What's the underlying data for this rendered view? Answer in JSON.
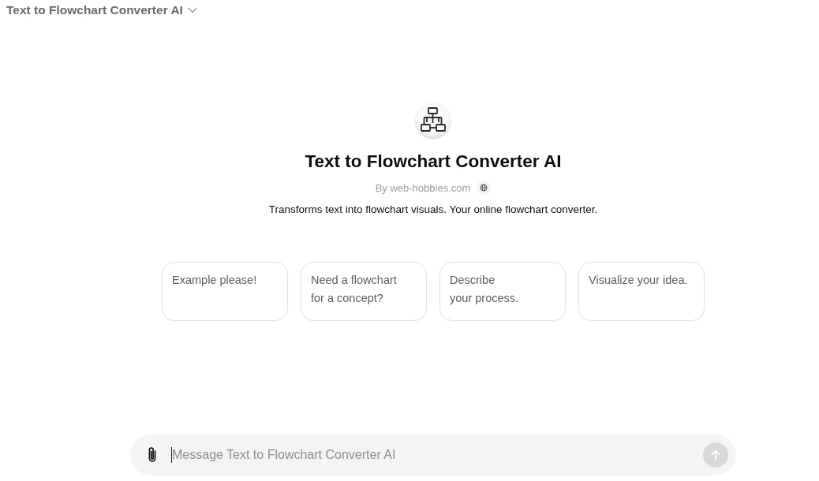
{
  "header": {
    "title": "Text to Flowchart Converter AI"
  },
  "profile": {
    "name": "Text to Flowchart Converter AI",
    "author": "By web-hobbies.com",
    "description": "Transforms text into flowchart visuals. Your online flowchart converter."
  },
  "suggestions": [
    "Example please!",
    "Need a flowchart\nfor a concept?",
    "Describe\nyour process.",
    "Visualize your idea."
  ],
  "composer": {
    "placeholder": "Message Text to Flowchart Converter AI",
    "send_disabled": true
  }
}
